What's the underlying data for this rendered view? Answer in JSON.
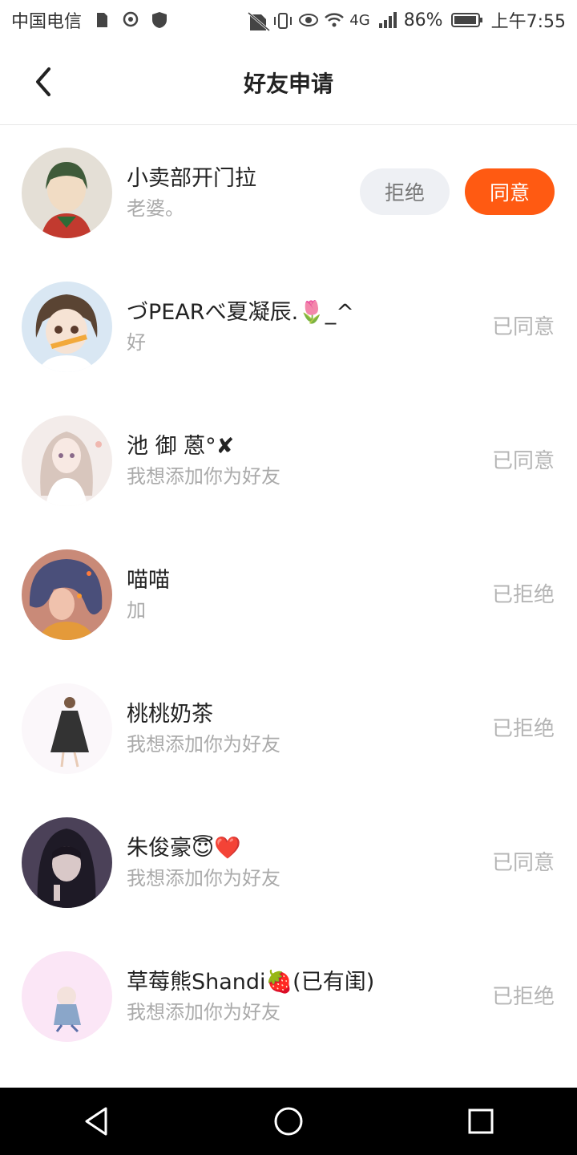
{
  "status_bar": {
    "carrier": "中国电信",
    "lte": "4G",
    "battery": "86%",
    "time": "上午7:55"
  },
  "header": {
    "title": "好友申请"
  },
  "requests": [
    {
      "name": "小卖部开门拉",
      "message": "老婆。",
      "state": "pending",
      "reject_label": "拒绝",
      "accept_label": "同意",
      "avatar_bg": "#e4dfd6",
      "avatar_fg": "#3f5b3a"
    },
    {
      "name": "づPEARべ夏凝辰.🌷_^",
      "message": "好",
      "state": "已同意",
      "avatar_bg": "#d9e7f3",
      "avatar_fg": "#5a4433"
    },
    {
      "name": "池 御 蒽°✘",
      "message": "我想添加你为好友",
      "state": "已同意",
      "avatar_bg": "#f3ecea",
      "avatar_fg": "#d8c6bd"
    },
    {
      "name": "喵喵",
      "message": "加",
      "state": "已拒绝",
      "avatar_bg": "#c98a78",
      "avatar_fg": "#4a4f7a"
    },
    {
      "name": "桃桃奶茶",
      "message": "我想添加你为好友",
      "state": "已拒绝",
      "avatar_bg": "#fbf7fa",
      "avatar_fg": "#333333"
    },
    {
      "name": "朱俊豪😇❤️",
      "message": "我想添加你为好友",
      "state": "已同意",
      "avatar_bg": "#4b4158",
      "avatar_fg": "#1e1a26"
    },
    {
      "name": "草莓熊Shandi🍓(已有闺)",
      "message": "我想添加你为好友",
      "state": "已拒绝",
      "avatar_bg": "#fbe6f6",
      "avatar_fg": "#8aa6c9"
    }
  ]
}
